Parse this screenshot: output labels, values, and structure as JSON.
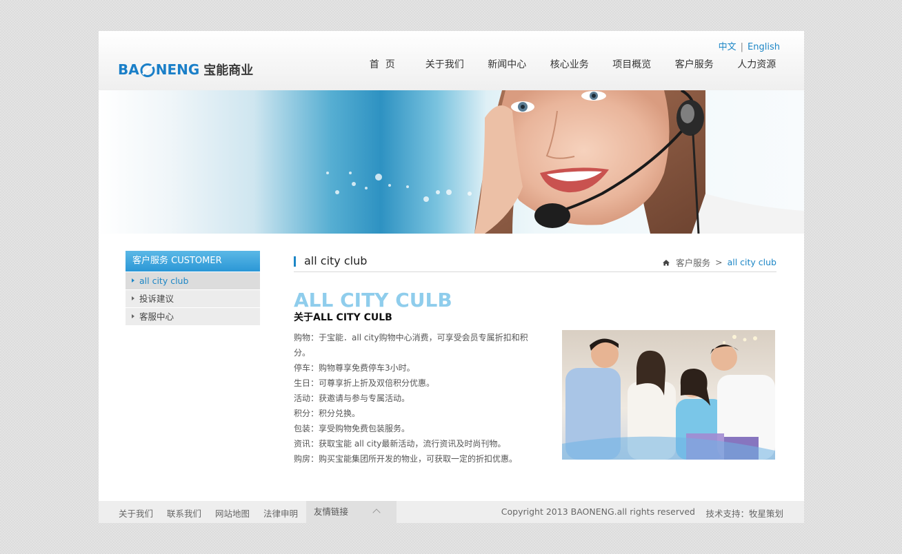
{
  "header": {
    "logo_en_left": "BA",
    "logo_en_right": "NENG",
    "logo_cn": "宝能商业",
    "lang": {
      "zh": "中文",
      "sep": "|",
      "en": "English"
    },
    "nav": [
      "首  页",
      "关于我们",
      "新闻中心",
      "核心业务",
      "项目概览",
      "客户服务",
      "人力资源"
    ]
  },
  "sidebar": {
    "title": "客户服务 CUSTOMER SERVICE",
    "items": [
      {
        "label": "all city club",
        "active": true
      },
      {
        "label": "投诉建议",
        "active": false
      },
      {
        "label": "客服中心",
        "active": false
      }
    ]
  },
  "content": {
    "heading": "all city club",
    "breadcrumb": {
      "parent": "客户服务",
      "sep": ">",
      "current": "all city club"
    },
    "big_title": "ALL CITY CULB",
    "sub_title": "关于ALL CITY CULB",
    "lines": [
      "购物：于宝能．all city购物中心消费，可享受会员专属折扣和积分。",
      "停车：购物尊享免费停车3小时。",
      "生日：可尊享折上折及双倍积分优惠。",
      "活动：获邀请与参与专属活动。",
      "积分：积分兑换。",
      "包装：享受购物免费包装服务。",
      "资讯：获取宝能 all city最新活动，流行资讯及时尚刊物。",
      "购房：购买宝能集团所开发的物业，可获取一定的折扣优惠。"
    ]
  },
  "footer": {
    "links": [
      "关于我们",
      "联系我们",
      "网站地图",
      "法律申明"
    ],
    "friend": "友情链接",
    "copyright": "Copyright 2013 BAONENG.all rights reserved",
    "support": "技术支持：牧星策划"
  },
  "colors": {
    "brand_blue": "#1c86c6",
    "title_light_blue": "#8fcdec",
    "sidebar_gradient": [
      "#5bb8e6",
      "#2b97d6"
    ]
  }
}
